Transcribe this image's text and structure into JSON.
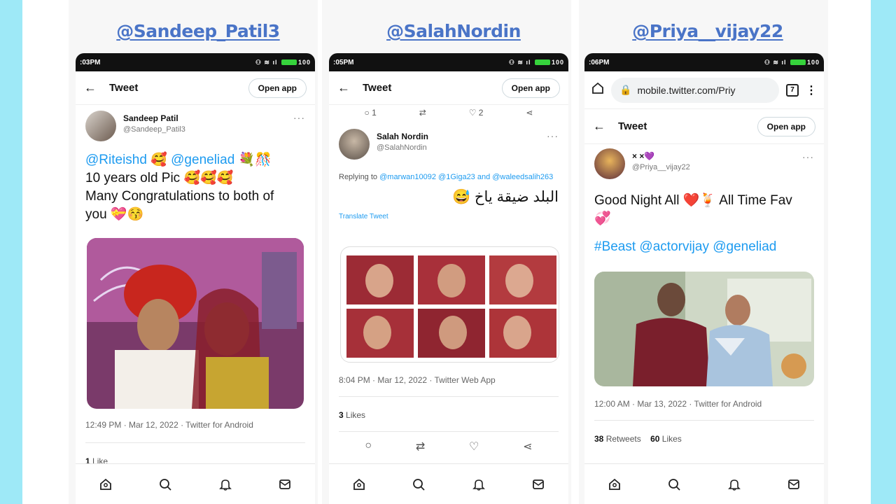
{
  "columns": [
    {
      "handle": "@Sandeep_Patil3",
      "status_time": ":03PM",
      "header_title": "Tweet",
      "open_app": "Open app",
      "author_name": "Sandeep Patil",
      "author_username": "@Sandeep_Patil3",
      "mentions": "@Riteishd 🥰 @geneliad 💐🎊",
      "line2": "10 years old Pic 🥰🥰🥰",
      "line3": "Many Congratulations to both of",
      "line4": "you 💝😚",
      "timestamp": "12:49 PM · Mar 12, 2022 · Twitter for Android",
      "likes_count": "1",
      "likes_label": "Like"
    },
    {
      "handle": "@SalahNordin",
      "status_time": ":05PM",
      "header_title": "Tweet",
      "open_app": "Open app",
      "top_reply_count": "1",
      "top_like_count": "2",
      "author_name": "Salah Nordin",
      "author_username": "@SalahNordin",
      "replying_prefix": "Replying to",
      "replying_users": "@marwan10092 @1Giga23 and @waleedsalih263",
      "arabic_text": "البلد ضيقة ياخ 😅",
      "translate": "Translate Tweet",
      "timestamp": "8:04 PM · Mar 12, 2022 · Twitter Web App",
      "likes_count": "3",
      "likes_label": "Likes"
    },
    {
      "handle": "@Priya__vijay22",
      "status_time": ":06PM",
      "url": "mobile.twitter.com/Priy",
      "tab_count": "7",
      "header_title": "Tweet",
      "open_app": "Open app",
      "author_name": "×  ×💜",
      "author_username": "@Priya__vijay22",
      "line1": "Good Night All ❤️🍹 All Time Fav",
      "line2": "💞",
      "hashtags": "#Beast @actorvijay @geneliad",
      "timestamp": "12:00 AM · Mar 13, 2022 · Twitter for Android",
      "retweets_count": "38",
      "retweets_label": "Retweets",
      "likes_count": "60",
      "likes_label": "Likes"
    }
  ],
  "colors": {
    "handle": "#4a74c7",
    "link": "#1d9bf0",
    "background": "#9ee9f7"
  }
}
